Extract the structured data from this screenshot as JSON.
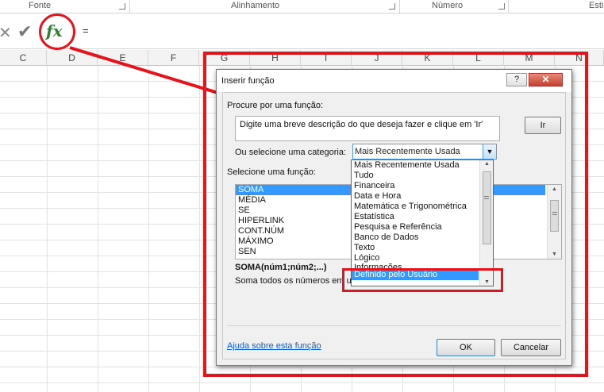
{
  "ribbon": {
    "groups": [
      {
        "label": "Fonte"
      },
      {
        "label": "Alinhamento"
      },
      {
        "label": "Número"
      },
      {
        "label": "Esti"
      }
    ]
  },
  "formula_bar": {
    "cancel_icon": "close-icon",
    "enter_icon": "check-icon",
    "fx_label": "fx",
    "content": "="
  },
  "columns": [
    "C",
    "D",
    "E",
    "F",
    "G",
    "H",
    "I",
    "J",
    "K",
    "L",
    "M",
    "N"
  ],
  "dialog": {
    "title": "Inserir função",
    "help_label": "?",
    "close_label": "✕",
    "search_label": "Procure por uma função:",
    "search_value": "Digite uma breve descrição do que deseja fazer e clique em 'Ir'",
    "go_label": "Ir",
    "category_label": "Ou selecione uma categoria:",
    "category_value": "Mais Recentemente Usada",
    "function_label": "Selecione uma função:",
    "functions": [
      "SOMA",
      "MÉDIA",
      "SE",
      "HIPERLINK",
      "CONT.NÚM",
      "MÁXIMO",
      "SEN"
    ],
    "selected_function": "SOMA",
    "syntax": "SOMA(núm1;núm2;...)",
    "description": "Soma todos os números em u",
    "help_link": "Ajuda sobre esta função",
    "ok_label": "OK",
    "cancel_label": "Cancelar"
  },
  "category_dropdown": {
    "options": [
      "Mais Recentemente Usada",
      "Tudo",
      "Financeira",
      "Data e Hora",
      "Matemática e Trigonométrica",
      "Estatística",
      "Pesquisa e Referência",
      "Banco de Dados",
      "Texto",
      "Lógico",
      "Informações",
      "Definido pelo Usuário"
    ],
    "selected": "Definido pelo Usuário"
  },
  "colors": {
    "annotation_red": "#e4141c",
    "selection_blue": "#3399ff",
    "fx_green": "#2e7d32"
  }
}
